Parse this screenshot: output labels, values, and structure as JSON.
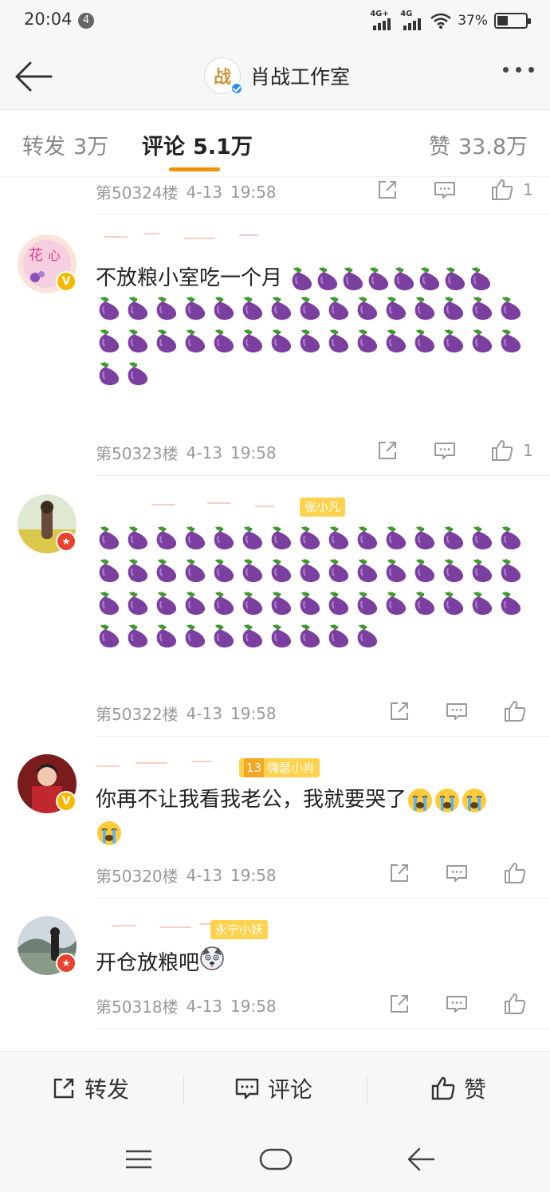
{
  "status_bar": {
    "time": "20:04",
    "notification_count": "4",
    "network_1": "4G+",
    "network_2": "4G",
    "battery_percent": "37%",
    "battery_level": 0.37
  },
  "header": {
    "title": "肖战工作室",
    "logo_glyph": "战"
  },
  "tabs": {
    "repost_label": "转发",
    "repost_count": "3万",
    "comment_label": "评论",
    "comment_count": "5.1万",
    "like_label": "赞",
    "like_count": "33.8万"
  },
  "colors": {
    "accent_orange": "#f29100",
    "fan_tag_yellow": "#ffd24d",
    "eggplant_purple": "#7b3fa0",
    "verify_blue": "#2d8cf0",
    "verify_gold": "#f6b800",
    "verify_red": "#e8412e"
  },
  "comments": [
    {
      "floor": "第50324楼",
      "date": "4-13",
      "time": "19:58",
      "likes": "1",
      "partial": true
    },
    {
      "floor": "第50323楼",
      "date": "4-13",
      "time": "19:58",
      "likes": "1",
      "text": "不放粮小室吃一个月",
      "eggplant_count": 40,
      "badge": "gold-v"
    },
    {
      "floor": "第50322楼",
      "date": "4-13",
      "time": "19:58",
      "likes": "",
      "fan_tag": "张小凡",
      "eggplant_count": 55,
      "badge": "red-star"
    },
    {
      "floor": "第50320楼",
      "date": "4-13",
      "time": "19:58",
      "likes": "",
      "fan_tag_level": "13",
      "fan_tag": "嗨瑟小肖",
      "text": "你再不让我看我老公，我就要哭了",
      "emoji": "crying-face",
      "badge": "gold-v"
    },
    {
      "floor": "第50318楼",
      "date": "4-13",
      "time": "19:58",
      "likes": "",
      "fan_tag": "永宁小妖",
      "text": "开仓放粮吧",
      "emoji": "husky-face",
      "badge": "red-star"
    }
  ],
  "bottom_bar": {
    "repost": "转发",
    "comment": "评论",
    "like": "赞"
  }
}
